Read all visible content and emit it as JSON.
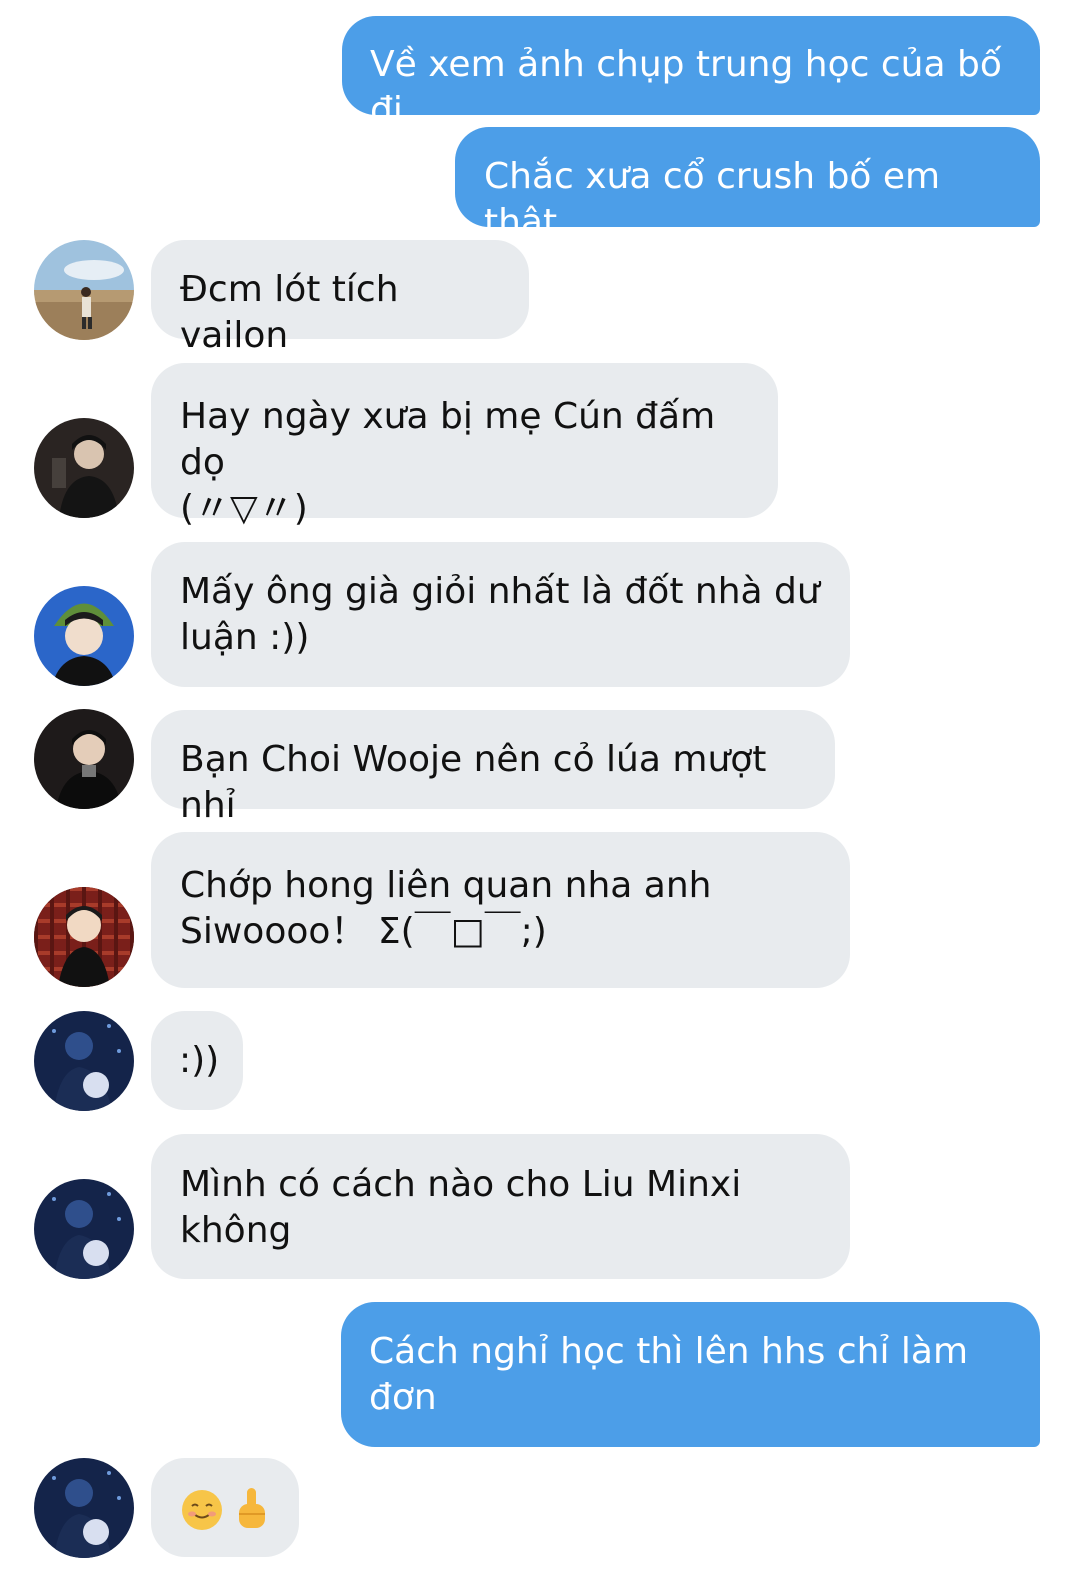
{
  "messages": [
    {
      "id": "m1",
      "direction": "sent",
      "text": "Về xem ảnh chụp trung học của bố đi"
    },
    {
      "id": "m2",
      "direction": "sent",
      "text": "Chắc xưa cổ crush bố em thật"
    },
    {
      "id": "m3",
      "direction": "received",
      "avatar": "avatar-field-photo",
      "text": "Đcm lót tích vailon"
    },
    {
      "id": "m4",
      "direction": "received",
      "avatar": "avatar-dark-portrait",
      "text": "Hay ngày xưa bị mẹ Cún đấm dọ\n(〃▽〃)"
    },
    {
      "id": "m5",
      "direction": "received",
      "avatar": "avatar-green-hat",
      "text": "Mấy ông già giỏi nhất là đốt nhà dư\nluận :))"
    },
    {
      "id": "m6",
      "direction": "received",
      "avatar": "avatar-black-coat",
      "text": "Bạn Choi Wooje nên cỏ lúa mượt nhỉ"
    },
    {
      "id": "m7",
      "direction": "received",
      "avatar": "avatar-red-plaid",
      "text": "Chớp hong liên quan nha anh\nSiwoooo！ Σ(￣□￣;)"
    },
    {
      "id": "m8",
      "direction": "received",
      "avatar": "avatar-blue-night",
      "text": ":))"
    },
    {
      "id": "m9",
      "direction": "received",
      "avatar": "avatar-blue-night",
      "text": "Mình có cách nào cho Liu Minxi\nkhông"
    },
    {
      "id": "m10",
      "direction": "sent",
      "text": "Cách nghỉ học thì lên hhs chỉ làm\nđơn"
    },
    {
      "id": "m11",
      "direction": "received",
      "avatar": "avatar-blue-night",
      "emojis": [
        "smiling-face-emoji",
        "hand-gesture-emoji"
      ]
    }
  ],
  "colors": {
    "sent_bubble": "#4c9ee8",
    "received_bubble": "#e8ebee",
    "background": "#ffffff"
  }
}
